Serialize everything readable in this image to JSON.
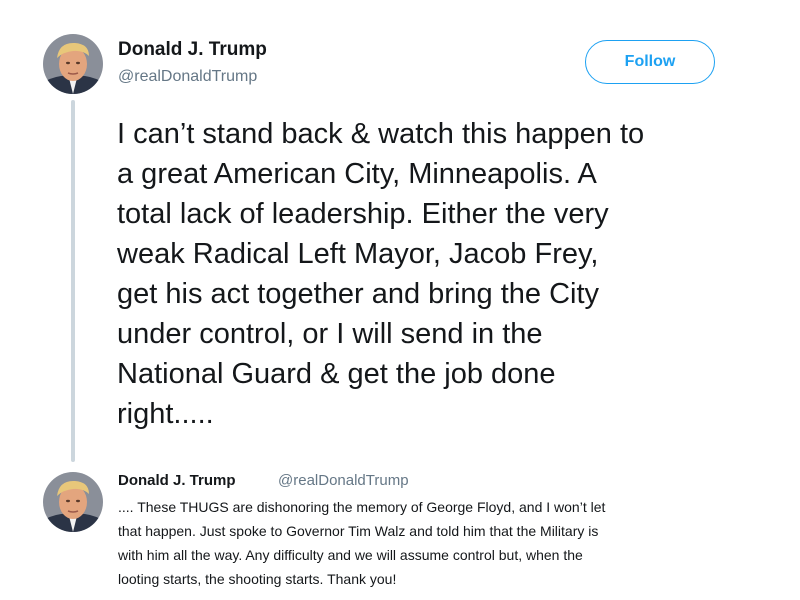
{
  "tweet": {
    "author_name": "Donald J. Trump",
    "author_handle": "@realDonaldTrump",
    "follow_label": "Follow",
    "text": "I can’t stand back & watch this happen to\na great American City, Minneapolis. A\ntotal lack of leadership. Either the very\nweak Radical Left Mayor, Jacob Frey,\nget his act together and bring the City\nunder control, or I will send in the\nNational Guard & get the job done\nright....."
  },
  "reply": {
    "author_name": "Donald J. Trump",
    "author_handle": "@realDonaldTrump",
    "text": ".... These THUGS are dishonoring the memory of George Floyd, and I won’t let\nthat happen. Just spoke to Governor Tim Walz and told him that the Military is\nwith him all the way. Any difficulty and we will assume control but, when the\nlooting starts, the shooting starts. Thank you!"
  },
  "colors": {
    "accent": "#1da1f2",
    "text": "#14171a",
    "secondary_text": "#657786",
    "thread_line": "#ccd6dd"
  }
}
